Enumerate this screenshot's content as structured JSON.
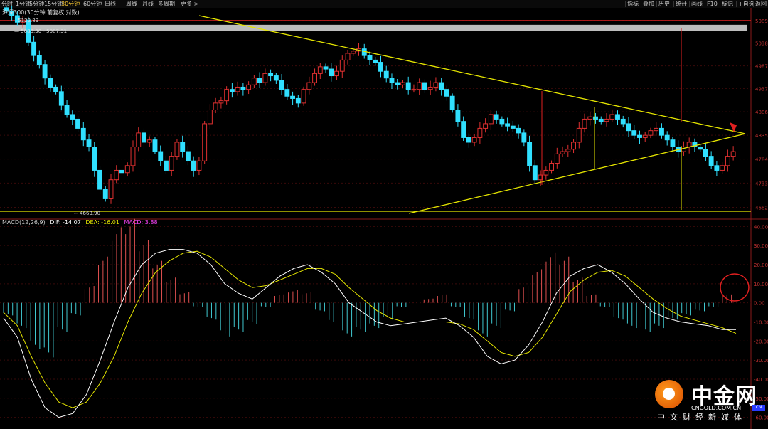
{
  "toolbar": {
    "timeframes": [
      "分时",
      "1分钟",
      "5分钟",
      "15分钟",
      "30分钟",
      "60分钟",
      "日线",
      "周线",
      "月线",
      "多周期",
      "更多 >"
    ],
    "active_timeframe": "30分钟",
    "tools": [
      "指标",
      "叠加",
      "历史",
      "统计",
      "画线",
      "F10",
      "标记",
      "+自选",
      "返回"
    ]
  },
  "chart_title": "沪深300(30分钟 前复权 对数)",
  "top_label": "5122.89",
  "band_label": "5080.30 - 5087.31",
  "low_label": "4663.90",
  "macd": {
    "label": "MACD(12,26,9)",
    "dif_label": "DIF: -14.07",
    "dea_label": "DEA: -16.01",
    "macd_label": "MACD: 3.88",
    "colors": {
      "dif": "#ffffff",
      "dea": "#e6e600",
      "macd": "#ff44ff",
      "pos": "#e05050",
      "neg": "#40c8d0"
    }
  },
  "logo": {
    "main": "中金网",
    "url": "CNGOLD.COM.CN",
    "sub": "中文财经新媒体"
  },
  "corner_tag": "CN",
  "chart_data": [
    {
      "type": "candlestick",
      "scale": "log",
      "yticks": [
        "5089",
        "5038",
        "4987",
        "4937",
        "4886",
        "4835",
        "4784",
        "4733",
        "4682"
      ],
      "ylim": [
        4662,
        5100
      ],
      "close_path": [
        5110,
        5100,
        5085,
        5090,
        5040,
        5010,
        4990,
        4960,
        4940,
        4930,
        4900,
        4880,
        4870,
        4850,
        4825,
        4810,
        4760,
        4720,
        4700,
        4740,
        4760,
        4755,
        4770,
        4810,
        4840,
        4820,
        4825,
        4800,
        4780,
        4760,
        4790,
        4820,
        4800,
        4780,
        4760,
        4780,
        4860,
        4890,
        4905,
        4910,
        4935,
        4930,
        4940,
        4935,
        4945,
        4960,
        4950,
        4970,
        4965,
        4955,
        4935,
        4920,
        4915,
        4905,
        4935,
        4950,
        4970,
        4985,
        4980,
        4965,
        4975,
        5000,
        5015,
        5020,
        5025,
        5010,
        5000,
        4995,
        4975,
        4960,
        4950,
        4945,
        4950,
        4935,
        4935,
        4950,
        4935,
        4940,
        4950,
        4935,
        4920,
        4890,
        4865,
        4830,
        4820,
        4830,
        4850,
        4860,
        4880,
        4870,
        4860,
        4855,
        4850,
        4840,
        4820,
        4770,
        4740,
        4750,
        4760,
        4775,
        4795,
        4800,
        4805,
        4820,
        4850,
        4870,
        4875,
        4870,
        4865,
        4870,
        4880,
        4870,
        4860,
        4845,
        4835,
        4830,
        4835,
        4845,
        4850,
        4835,
        4825,
        4810,
        4800,
        4810,
        4820,
        4810,
        4805,
        4790,
        4770,
        4760,
        4770,
        4790,
        4800
      ],
      "annotations": [
        "5122.89",
        "5080.30 - 5087.31",
        "4663.90"
      ],
      "trendlines": [
        "descending resistance",
        "ascending support",
        "horizontal support 4663.90",
        "horizontal resistance 5089"
      ],
      "grid": false
    },
    {
      "type": "bar",
      "title": "MACD(12,26,9)",
      "yticks": [
        "40.00",
        "30.00",
        "20.00",
        "10.00",
        "0.00",
        "-10.00",
        "-20.00",
        "-30.00",
        "-40.00",
        "-50.00",
        "-60.00"
      ],
      "ylim": [
        -65,
        42
      ],
      "series": [
        {
          "name": "DIF",
          "values": [
            -8,
            -18,
            -40,
            -55,
            -60,
            -58,
            -48,
            -30,
            -10,
            8,
            20,
            26,
            28,
            28,
            26,
            20,
            10,
            5,
            2,
            8,
            14,
            18,
            20,
            16,
            10,
            0,
            -5,
            -10,
            -12,
            -11,
            -10,
            -9,
            -8,
            -12,
            -18,
            -28,
            -32,
            -30,
            -22,
            -10,
            5,
            14,
            18,
            20,
            16,
            10,
            2,
            -5,
            -8,
            -10,
            -11,
            -12,
            -14,
            -14
          ]
        },
        {
          "name": "DEA",
          "values": [
            -5,
            -12,
            -28,
            -42,
            -52,
            -55,
            -52,
            -42,
            -28,
            -10,
            5,
            16,
            22,
            26,
            27,
            24,
            18,
            12,
            8,
            9,
            12,
            15,
            18,
            18,
            15,
            8,
            2,
            -4,
            -8,
            -10,
            -10,
            -10,
            -10,
            -11,
            -14,
            -20,
            -26,
            -28,
            -26,
            -18,
            -6,
            6,
            12,
            16,
            17,
            14,
            8,
            2,
            -3,
            -7,
            -9,
            -11,
            -13,
            -16
          ]
        },
        {
          "name": "MACD",
          "values": [
            -6,
            -12,
            -22,
            -26,
            -14,
            -6,
            8,
            22,
            36,
            40,
            30,
            20,
            12,
            5,
            -2,
            -8,
            -16,
            -14,
            -10,
            -2,
            4,
            6,
            5,
            -4,
            -10,
            -16,
            -14,
            -12,
            -8,
            -2,
            0,
            2,
            4,
            -2,
            -8,
            -16,
            -12,
            -4,
            8,
            16,
            24,
            22,
            12,
            4,
            -2,
            -8,
            -12,
            -14,
            -12,
            -8,
            -6,
            -4,
            -2,
            4
          ]
        }
      ]
    }
  ]
}
